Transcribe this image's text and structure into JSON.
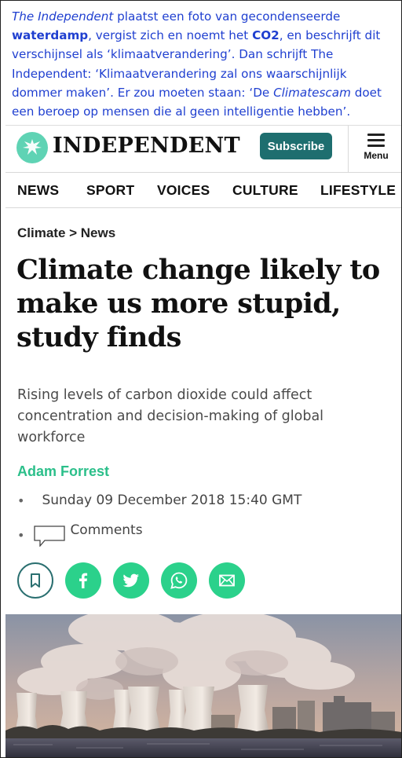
{
  "caption": {
    "t1": "The Independent",
    "t2": " plaatst een foto van gecondenseerde ",
    "t3": "waterdamp",
    "t4": ", vergist zich en noemt het ",
    "t5": "CO2",
    "t6": ", en beschrijft dit verschijnsel als ‘klimaatverandering’. Dan schrijft The Independent: ‘Klimaatverandering zal ons waarschijnlijk dommer maken’. Er zou moeten staan: ‘De ",
    "t7": "Climatescam",
    "t8": " doet een beroep op mensen die al geen intelligentie hebben’."
  },
  "header": {
    "logo_text": "INDEPENDENT",
    "subscribe_label": "Subscribe",
    "menu_label": "Menu"
  },
  "nav": {
    "items": [
      "NEWS",
      "SPORT",
      "VOICES",
      "CULTURE",
      "LIFESTYLE"
    ]
  },
  "article": {
    "breadcrumb": "Climate > News",
    "headline": "Climate change likely to make us more stupid, study finds",
    "standfirst": "Rising levels of carbon dioxide could affect concentration and decision-making of global workforce",
    "author": "Adam Forrest",
    "bullet": "•",
    "date": "Sunday 09 December 2018 15:40 GMT",
    "comments_label": "Comments"
  },
  "share": {
    "icons": [
      "bookmark-icon",
      "facebook-icon",
      "twitter-icon",
      "whatsapp-icon",
      "email-icon"
    ]
  },
  "colors": {
    "caption_blue": "#1f3fd0",
    "brand_teal": "#1e6e6f",
    "accent_green": "#2bd18b",
    "author_green": "#2bbf8a"
  }
}
